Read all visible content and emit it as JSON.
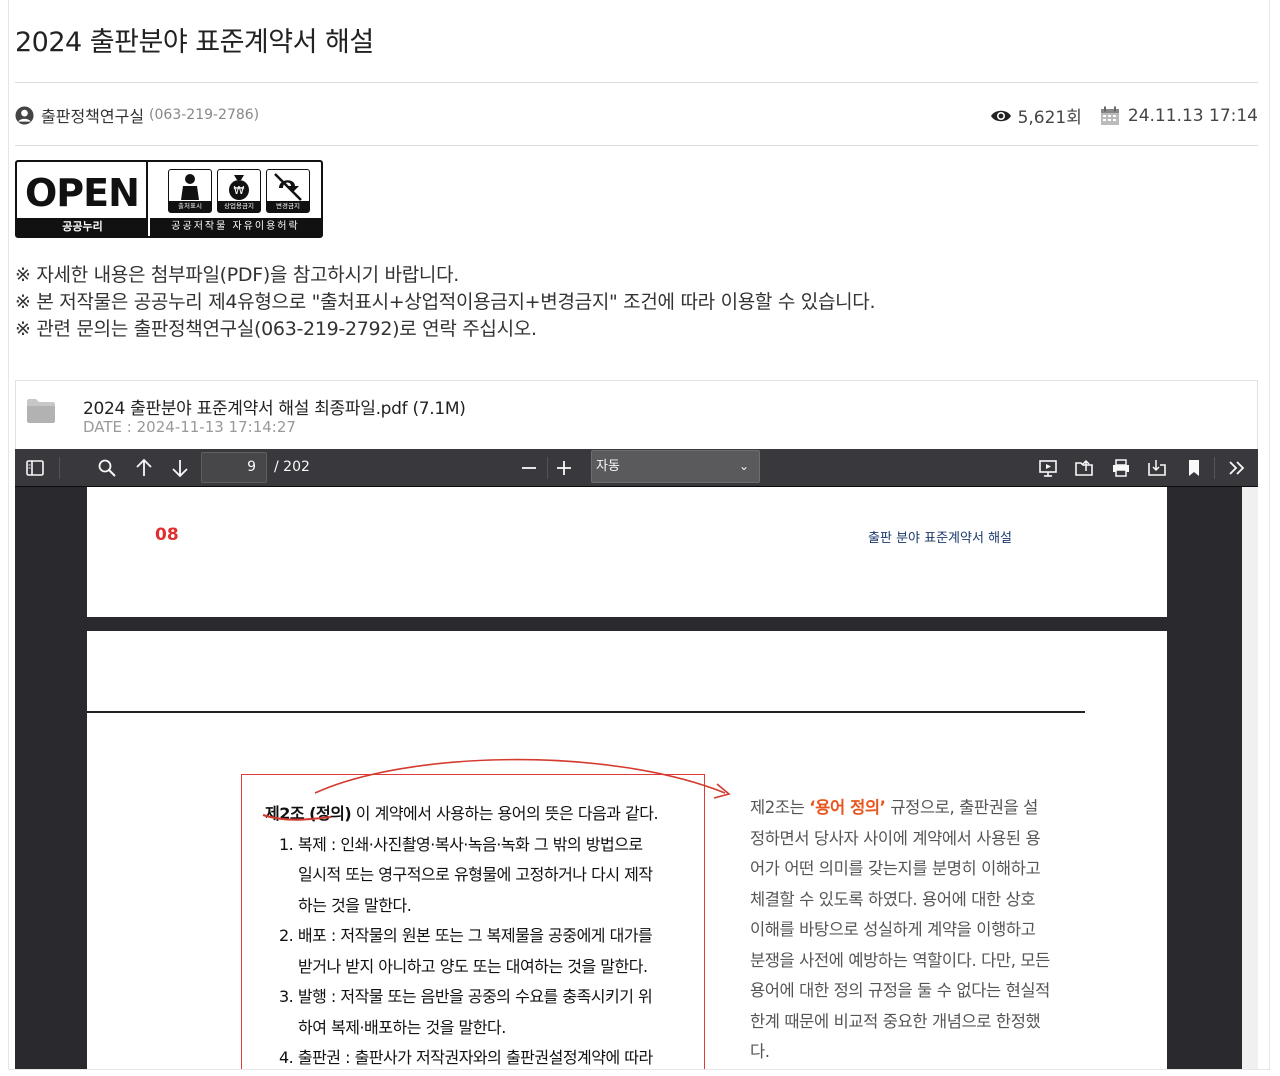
{
  "title": "2024 출판분야 표준계약서 해설",
  "author": {
    "name": "출판정책연구실",
    "phone": "(063-219-2786)"
  },
  "meta": {
    "views": "5,621회",
    "datetime": "24.11.13 17:14"
  },
  "open_badge": {
    "word": "OPEN",
    "left_label": "공공누리",
    "icons": [
      {
        "name": "attribution-icon",
        "label": "출처표시"
      },
      {
        "name": "noncommercial-icon",
        "label": "상업용금지"
      },
      {
        "name": "no-derivatives-icon",
        "label": "변경금지"
      }
    ],
    "right_label": "공공저작물 자유이용허락"
  },
  "notes": [
    "※ 자세한 내용은 첨부파일(PDF)을 참고하시기 바랍니다.",
    "※ 본 저작물은 공공누리 제4유형으로 \"출처표시+상업적이용금지+변경금지\" 조건에 따라 이용할 수 있습니다.",
    "※ 관련 문의는 출판정책연구실(063-219-2792)로 연락 주십시오."
  ],
  "attachment": {
    "filename": "2024 출판분야 표준계약서 해설 최종파일.pdf (7.1M)",
    "date": "DATE : 2024-11-13 17:14:27"
  },
  "viewer": {
    "page_number": "9",
    "page_count": "/ 202",
    "zoom": "자동",
    "page1": {
      "number": "08",
      "header": "출판 분야 표준계약서 해설"
    },
    "article": {
      "head": "제2조 (정의)",
      "head_rest": " 이 계약에서 사용하는 용어의 뜻은 다음과 같다.",
      "lines": [
        "1. 복제 : 인쇄·사진촬영·복사·녹음·녹화 그 밖의 방법으로",
        "일시적 또는 영구적으로 유형물에 고정하거나 다시 제작",
        "하는 것을 말한다.",
        "2. 배포 : 저작물의 원본 또는 그 복제물을 공중에게 대가를",
        "받거나 받지 아니하고 양도 또는 대여하는 것을 말한다.",
        "3. 발행 : 저작물 또는 음반을 공중의 수요를 충족시키기 위",
        "하여 복제·배포하는 것을 말한다.",
        "4. 출판권 : 출판사가 저작권자와의 출판권설정계약에 따라"
      ]
    },
    "side": {
      "pre": "제2조는 ",
      "em": "‘용어 정의’",
      "post": " 규정으로, 출판권을 설정하면서 당사자 사이에 계약에서 사용된 용어가 어떤 의미를 갖는지를 분명히 이해하고 체결할 수 있도록 하였다. 용어에 대한 상호 이해를 바탕으로 성실하게 계약을 이행하고 분쟁을 사전에 예방하는 역할이다. 다만, 모든 용어에 대한 정의 규정을 둘 수 없다는 현실적 한계 때문에 비교적 중요한 개념으로 한정했다."
    }
  },
  "colors": {
    "accent_red": "#e23a3a",
    "accent_orange": "#e8561e",
    "toolbar": "#38383d"
  }
}
